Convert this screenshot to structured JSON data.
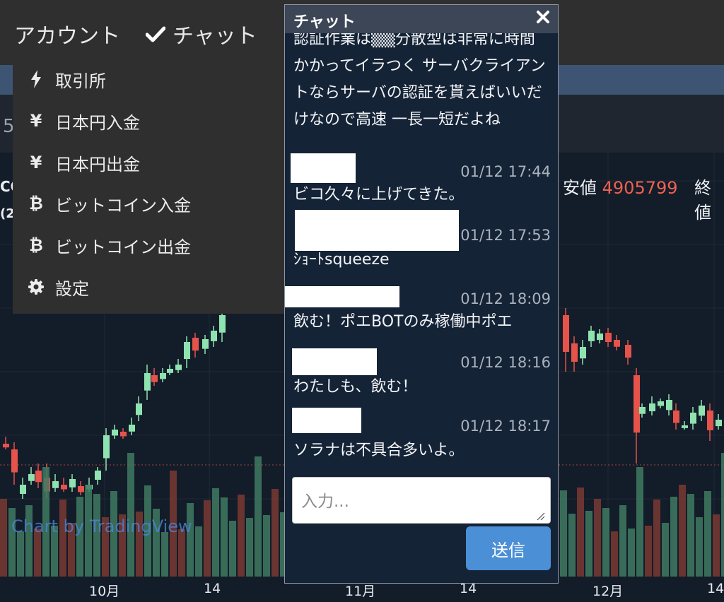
{
  "nav": {
    "account_label": "アカウント",
    "chat_label": "チャット"
  },
  "price_fragment": "5",
  "left_fragments": {
    "a": "CO",
    "b": "(2"
  },
  "stats": {
    "low_label": "安値",
    "low_value": "4905799",
    "close_label": "終値"
  },
  "dropdown": {
    "items": [
      {
        "label": "取引所",
        "icon": "lightning-icon"
      },
      {
        "label": "日本円入金",
        "icon": "yen-icon"
      },
      {
        "label": "日本円出金",
        "icon": "yen-icon"
      },
      {
        "label": "ビットコイン入金",
        "icon": "bitcoin-icon"
      },
      {
        "label": "ビットコイン出金",
        "icon": "bitcoin-icon"
      },
      {
        "label": "設定",
        "icon": "gear-icon"
      }
    ]
  },
  "chart": {
    "watermark": "Chart by TradingView",
    "x_ticks": [
      "10月",
      "14",
      "11月",
      "14",
      "12月",
      "14"
    ],
    "colors": {
      "up": "#8fe3b0",
      "down": "#e5534b",
      "vol_up": "#3f7a61",
      "vol_down": "#7a3833"
    }
  },
  "chat": {
    "title": "チャット",
    "partial_text": "認証作業は▒▒分散型は非常に時間かかってイラつく サーバクライアントならサーバの認証を貰えばいいだけなので高速 一長一短だよね",
    "messages": [
      {
        "time": "01/12 17:44",
        "text": "ビコ久々に上げてきた。"
      },
      {
        "time": "01/12 17:53",
        "text": "ｼｮｰﾄsqueeze"
      },
      {
        "time": "01/12 18:09",
        "text": "飲む！ポエBOTのみ稼働中ポエ"
      },
      {
        "time": "01/12 18:16",
        "text": "わたしも、飲む！"
      },
      {
        "time": "01/12 18:17",
        "text": "ソラナは不具合多いよ。"
      }
    ],
    "input_placeholder": "入力...",
    "send_label": "送信"
  }
}
